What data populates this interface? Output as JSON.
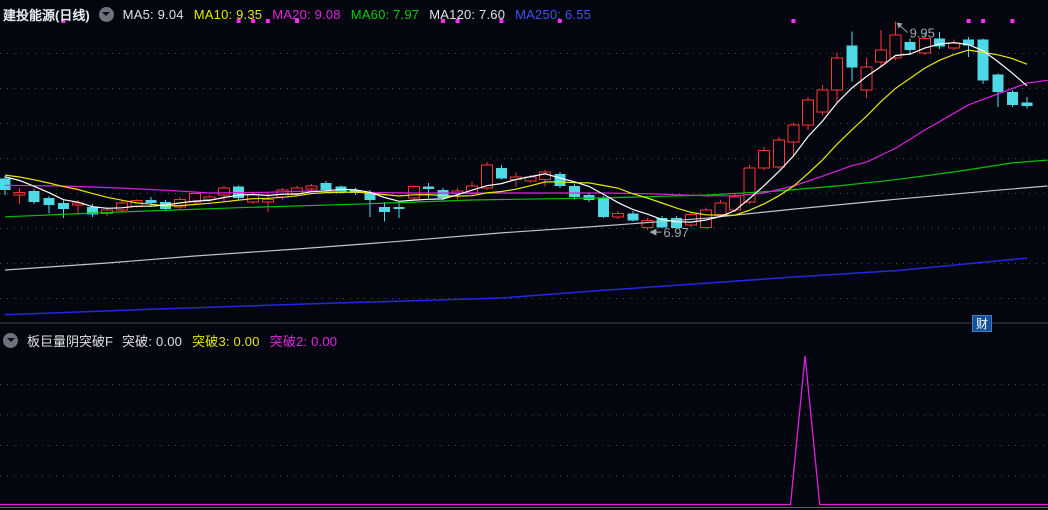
{
  "header": {
    "title": "建投能源(日线)",
    "mas": [
      {
        "label": "MA5",
        "value": "9.04",
        "color": "#e2e2e2"
      },
      {
        "label": "MA10",
        "value": "9.35",
        "color": "#e8e800"
      },
      {
        "label": "MA20",
        "value": "9.08",
        "color": "#e026e0"
      },
      {
        "label": "MA60",
        "value": "7.97",
        "color": "#00d000"
      },
      {
        "label": "MA120",
        "value": "7.60",
        "color": "#e2e2e2"
      },
      {
        "label": "MA250",
        "value": "6.55",
        "color": "#3c55f0"
      }
    ]
  },
  "sub_header": {
    "title": "板巨量阴突破F",
    "fields": [
      {
        "label": "突破",
        "value": "0.00",
        "color": "#e2e2e2"
      },
      {
        "label": "突破3",
        "value": "0.00",
        "color": "#e8e800"
      },
      {
        "label": "突破2",
        "value": "0.00",
        "color": "#e026e0"
      }
    ]
  },
  "badge": "财",
  "colors": {
    "background": "#04060f",
    "up": "#ff3434",
    "down": "#4fd9e6",
    "ma5": "#ffffff",
    "ma10": "#e8e800",
    "ma20": "#dd22dd",
    "ma60": "#00c400",
    "ma120": "#c2c2ca",
    "ma250": "#2228e0",
    "grid": "#4e4e58",
    "signal": "#dd22dd",
    "marker_dot": "#ff2bff",
    "annotation": "#a0a6ae",
    "badge_bg": "#15519a",
    "badge_border": "#3f7fc0"
  },
  "chart_data": {
    "type": "candlestick",
    "title": "建投能源(日线)",
    "main": {
      "ylim": [
        5.66,
        9.83
      ],
      "grid_prices": [
        9.5,
        9.0,
        8.5,
        8.0,
        7.5,
        7.0,
        6.5,
        6.0
      ],
      "grid_on": true,
      "ma_prehistory": 7.78,
      "candles": [
        [
          7.71,
          7.54,
          7.74,
          7.47,
          "d"
        ],
        [
          7.47,
          7.51,
          7.57,
          7.34,
          "u"
        ],
        [
          7.53,
          7.37,
          7.56,
          7.34,
          "d"
        ],
        [
          7.43,
          7.33,
          7.46,
          7.21,
          "d"
        ],
        [
          7.36,
          7.27,
          7.39,
          7.14,
          "d"
        ],
        [
          7.33,
          7.36,
          7.4,
          7.21,
          "u"
        ],
        [
          7.3,
          7.19,
          7.34,
          7.16,
          "d"
        ],
        [
          7.21,
          7.26,
          7.3,
          7.17,
          "u"
        ],
        [
          7.26,
          7.36,
          7.39,
          7.23,
          "u"
        ],
        [
          7.31,
          7.39,
          7.41,
          7.29,
          "u"
        ],
        [
          7.4,
          7.36,
          7.44,
          7.31,
          "d"
        ],
        [
          7.37,
          7.27,
          7.4,
          7.24,
          "d"
        ],
        [
          7.3,
          7.41,
          7.44,
          7.27,
          "u"
        ],
        [
          7.37,
          7.49,
          7.51,
          7.34,
          "u"
        ],
        [
          7.41,
          7.44,
          7.47,
          7.37,
          "u"
        ],
        [
          7.47,
          7.57,
          7.6,
          7.37,
          "u"
        ],
        [
          7.59,
          7.43,
          7.61,
          7.4,
          "d"
        ],
        [
          7.37,
          7.47,
          7.5,
          7.34,
          "u"
        ],
        [
          7.37,
          7.41,
          7.5,
          7.23,
          "u"
        ],
        [
          7.44,
          7.54,
          7.57,
          7.41,
          "u"
        ],
        [
          7.49,
          7.57,
          7.6,
          7.46,
          "u"
        ],
        [
          7.56,
          7.6,
          7.63,
          7.53,
          "u"
        ],
        [
          7.64,
          7.54,
          7.67,
          7.51,
          "d"
        ],
        [
          7.59,
          7.51,
          7.61,
          7.49,
          "d"
        ],
        [
          7.54,
          7.5,
          7.57,
          7.47,
          "d"
        ],
        [
          7.51,
          7.4,
          7.54,
          7.16,
          "d"
        ],
        [
          7.3,
          7.23,
          7.37,
          7.09,
          "d"
        ],
        [
          7.3,
          7.27,
          7.36,
          7.14,
          "d"
        ],
        [
          7.43,
          7.59,
          7.61,
          7.4,
          "u"
        ],
        [
          7.59,
          7.56,
          7.64,
          7.43,
          "d"
        ],
        [
          7.54,
          7.43,
          7.57,
          7.4,
          "d"
        ],
        [
          7.49,
          7.53,
          7.57,
          7.41,
          "u"
        ],
        [
          7.49,
          7.6,
          7.66,
          7.46,
          "u"
        ],
        [
          7.57,
          7.9,
          7.94,
          7.54,
          "u"
        ],
        [
          7.86,
          7.71,
          7.9,
          7.69,
          "d"
        ],
        [
          7.69,
          7.73,
          7.79,
          7.59,
          "u"
        ],
        [
          7.67,
          7.73,
          7.76,
          7.64,
          "u"
        ],
        [
          7.69,
          7.8,
          7.83,
          7.59,
          "u"
        ],
        [
          7.77,
          7.6,
          7.8,
          7.57,
          "d"
        ],
        [
          7.6,
          7.44,
          7.63,
          7.41,
          "d"
        ],
        [
          7.47,
          7.4,
          7.5,
          7.37,
          "d"
        ],
        [
          7.43,
          7.16,
          7.46,
          7.14,
          "d"
        ],
        [
          7.16,
          7.21,
          7.24,
          7.13,
          "u"
        ],
        [
          7.21,
          7.11,
          7.24,
          7.09,
          "d"
        ],
        [
          7.01,
          7.11,
          7.14,
          6.97,
          "u"
        ],
        [
          7.14,
          7.01,
          7.17,
          6.99,
          "d"
        ],
        [
          7.14,
          7.0,
          7.17,
          6.99,
          "d"
        ],
        [
          7.04,
          7.19,
          7.23,
          7.01,
          "u"
        ],
        [
          7.01,
          7.26,
          7.29,
          6.99,
          "u"
        ],
        [
          7.19,
          7.36,
          7.4,
          7.16,
          "u"
        ],
        [
          7.26,
          7.44,
          7.49,
          7.23,
          "u"
        ],
        [
          7.37,
          7.86,
          7.9,
          7.34,
          "u"
        ],
        [
          7.86,
          8.11,
          8.16,
          7.83,
          "u"
        ],
        [
          7.87,
          8.26,
          8.3,
          7.84,
          "u"
        ],
        [
          8.23,
          8.47,
          8.51,
          8.03,
          "u"
        ],
        [
          8.47,
          8.83,
          8.87,
          8.4,
          "u"
        ],
        [
          8.66,
          8.97,
          9.04,
          8.61,
          "u"
        ],
        [
          8.97,
          9.43,
          9.51,
          8.79,
          "u"
        ],
        [
          9.61,
          9.29,
          9.81,
          9.09,
          "d"
        ],
        [
          8.97,
          9.3,
          9.43,
          8.86,
          "u"
        ],
        [
          9.37,
          9.54,
          9.83,
          9.3,
          "u"
        ],
        [
          9.43,
          9.76,
          9.95,
          9.4,
          "u"
        ],
        [
          9.66,
          9.54,
          9.71,
          9.47,
          "d"
        ],
        [
          9.5,
          9.71,
          9.79,
          9.47,
          "u"
        ],
        [
          9.71,
          9.59,
          9.8,
          9.56,
          "d"
        ],
        [
          9.57,
          9.64,
          9.69,
          9.54,
          "u"
        ],
        [
          9.69,
          9.61,
          9.73,
          9.44,
          "d"
        ],
        [
          9.69,
          9.11,
          9.71,
          9.06,
          "d"
        ],
        [
          9.19,
          8.94,
          9.21,
          8.73,
          "d"
        ],
        [
          8.94,
          8.76,
          8.97,
          8.73,
          "d"
        ],
        [
          8.79,
          8.74,
          8.87,
          8.71,
          "d"
        ]
      ],
      "ma_lines": {
        "ma20": [
          [
            0,
            7.61
          ],
          [
            4,
            7.6
          ],
          [
            8,
            7.57
          ],
          [
            11,
            7.54
          ],
          [
            14,
            7.5
          ],
          [
            18,
            7.51
          ],
          [
            21,
            7.53
          ],
          [
            24,
            7.51
          ],
          [
            28,
            7.5
          ],
          [
            37,
            7.5
          ],
          [
            41,
            7.5
          ],
          [
            44,
            7.49
          ],
          [
            48,
            7.46
          ],
          [
            50,
            7.46
          ],
          [
            52,
            7.5
          ],
          [
            54,
            7.6
          ],
          [
            56,
            7.74
          ],
          [
            58,
            7.89
          ],
          [
            59,
            7.94
          ],
          [
            61,
            8.14
          ],
          [
            63,
            8.4
          ],
          [
            66,
            8.76
          ],
          [
            70,
            9.07
          ],
          [
            71.4,
            9.11
          ]
        ],
        "ma60": [
          [
            0,
            7.16
          ],
          [
            8,
            7.23
          ],
          [
            16,
            7.29
          ],
          [
            24,
            7.34
          ],
          [
            32,
            7.4
          ],
          [
            41,
            7.43
          ],
          [
            48,
            7.47
          ],
          [
            53,
            7.53
          ],
          [
            57,
            7.6
          ],
          [
            61,
            7.69
          ],
          [
            65,
            7.8
          ],
          [
            69,
            7.93
          ],
          [
            71.4,
            7.97
          ]
        ],
        "ma120": [
          [
            0,
            6.4
          ],
          [
            7,
            6.5
          ],
          [
            13,
            6.6
          ],
          [
            20,
            6.7
          ],
          [
            27,
            6.81
          ],
          [
            34,
            6.93
          ],
          [
            41,
            7.03
          ],
          [
            48,
            7.14
          ],
          [
            54,
            7.27
          ],
          [
            61,
            7.41
          ],
          [
            68,
            7.54
          ],
          [
            71.4,
            7.6
          ]
        ],
        "ma250": [
          [
            0,
            5.76
          ],
          [
            10,
            5.84
          ],
          [
            20,
            5.91
          ],
          [
            34,
            6.0
          ],
          [
            41,
            6.11
          ],
          [
            48,
            6.21
          ],
          [
            54,
            6.3
          ],
          [
            61,
            6.39
          ],
          [
            68,
            6.53
          ],
          [
            70,
            6.57
          ]
        ]
      },
      "annotations": {
        "high": {
          "bar": 61,
          "label": "9.95"
        },
        "low": {
          "bar": 44,
          "label": "6.97"
        }
      },
      "signal_dot_bars": [
        4,
        16,
        17,
        18,
        20,
        30,
        31,
        34,
        38,
        54,
        66,
        67,
        69
      ]
    },
    "sub": {
      "type": "line",
      "baseline_value": 0,
      "spike": {
        "bar_index": 54.8,
        "half_width_bars": 1.0,
        "peak_fraction": 1.0
      },
      "grid_on": true
    }
  }
}
